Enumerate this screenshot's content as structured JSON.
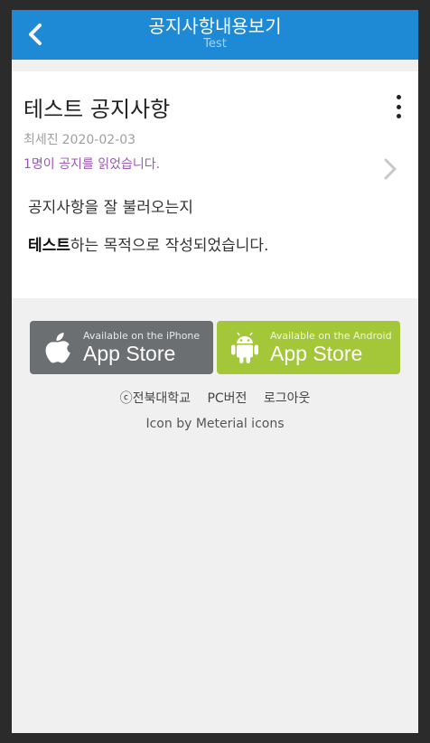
{
  "header": {
    "title": "공지사항내용보기",
    "subtitle": "Test"
  },
  "notice": {
    "title": "테스트 공지사항",
    "author": "최세진",
    "date": "2020-02-03",
    "read_status": "1명이 공지를 읽었습니다.",
    "body_line1": "공지사항을 잘 불러오는지",
    "body_line2_bold": "테스트",
    "body_line2_rest": "하는 목적으로 작성되었습니다."
  },
  "stores": {
    "ios": {
      "small": "Available on the iPhone",
      "big": "App Store",
      "icon": "apple-icon",
      "color": "#6c6f72"
    },
    "android": {
      "small": "Available on the Android",
      "big": "App Store",
      "icon": "android-icon",
      "color": "#a4c639"
    }
  },
  "footer": {
    "copyright": "ⓒ전북대학교",
    "pc_link": "PC버전",
    "logout_link": "로그아웃",
    "credit": "Icon by Meterial icons"
  },
  "colors": {
    "header_bg": "#1e8ad6",
    "read_status": "#9b59b6"
  }
}
